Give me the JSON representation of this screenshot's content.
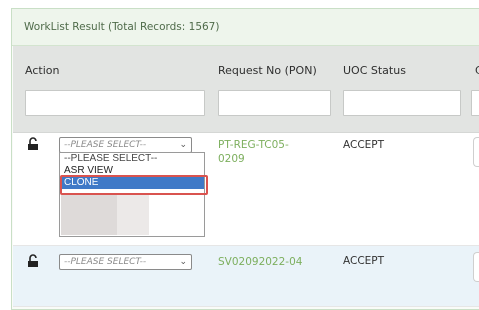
{
  "panel": {
    "title": "WorkList Result (Total Records: 1567)"
  },
  "table": {
    "headers": [
      "Action",
      "Request No (PON)",
      "UOC Status",
      "C"
    ],
    "rows": [
      {
        "action_placeholder": "--PLEASE SELECT--",
        "request_no": "PT-REG-TC05-\n0209",
        "uoc_status": "ACCEPT"
      },
      {
        "action_placeholder": "--PLEASE SELECT--",
        "request_no": "SV02092022-04",
        "uoc_status": "ACCEPT"
      }
    ]
  },
  "dropdown": {
    "options": [
      "--PLEASE SELECT--",
      "ASR VIEW",
      "CLONE"
    ],
    "selected": "CLONE"
  },
  "icons": {
    "lock": "unlock-icon",
    "chevron": "chevron-down-icon"
  },
  "colors": {
    "link": "#7daf5e",
    "selected": "#3f79c7",
    "highlight": "#d9534f"
  }
}
